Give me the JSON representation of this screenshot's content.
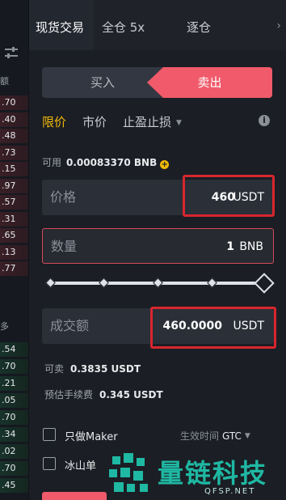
{
  "tabs": [
    {
      "label": "现货交易"
    },
    {
      "label": "全仓 5x"
    },
    {
      "label": "逐仓"
    }
  ],
  "side": {
    "buy_label": "买入",
    "sell_label": "卖出"
  },
  "order_types": {
    "limit": "限价",
    "market": "市价",
    "stop": "止盈止损"
  },
  "available": {
    "label": "可用",
    "value": "0.00083370 BNB"
  },
  "price_field": {
    "label": "价格",
    "value": "460",
    "unit": "USDT"
  },
  "qty_field": {
    "label": "数量",
    "value": "1",
    "unit": "BNB"
  },
  "total_field": {
    "label": "成交额",
    "value": "460.0000",
    "unit": "USDT"
  },
  "sell_amount": {
    "label": "可卖",
    "value": "0.3835 USDT"
  },
  "fee": {
    "label": "预估手续费",
    "value": "0.345 USDT"
  },
  "options": {
    "maker_only": "只做Maker",
    "iceberg": "冰山单",
    "time_in_force_label": "生效时间",
    "time_in_force_value": "GTC"
  },
  "left_strip": {
    "header": "额",
    "more": "多",
    "sell_prices": [
      ".70",
      ".40",
      ".48",
      ".73",
      ".15",
      ".97",
      ".57",
      ".31",
      ".65",
      ".13",
      ".77"
    ],
    "buy_prices": [
      ".54",
      ".70",
      ".21",
      ".05",
      ".70",
      ".34",
      ".02",
      ".70",
      ".45"
    ]
  },
  "watermark": {
    "text": "量链科技",
    "sub": "QFSP.NET"
  },
  "colors": {
    "accent_yellow": "#f0b90b",
    "sell_red": "#f05a6a",
    "highlight_red": "#d8262e"
  }
}
